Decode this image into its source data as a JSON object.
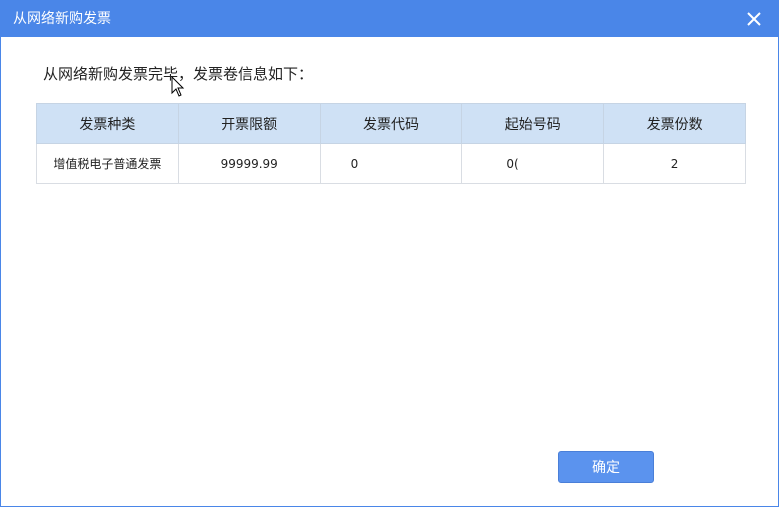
{
  "window": {
    "title": "从网络新购发票",
    "close_icon": "close-icon"
  },
  "message": "从网络新购发票完毕，发票卷信息如下：",
  "table": {
    "headers": [
      "发票种类",
      "开票限额",
      "发票代码",
      "起始号码",
      "发票份数"
    ],
    "rows": [
      [
        "增值税电子普通发票",
        "99999.99",
        "0",
        "0(",
        "2"
      ]
    ]
  },
  "buttons": {
    "ok_label": "确定"
  },
  "colors": {
    "titlebar": "#4a86e8",
    "header_bg": "#cfe1f5",
    "button": "#5b93ee"
  }
}
